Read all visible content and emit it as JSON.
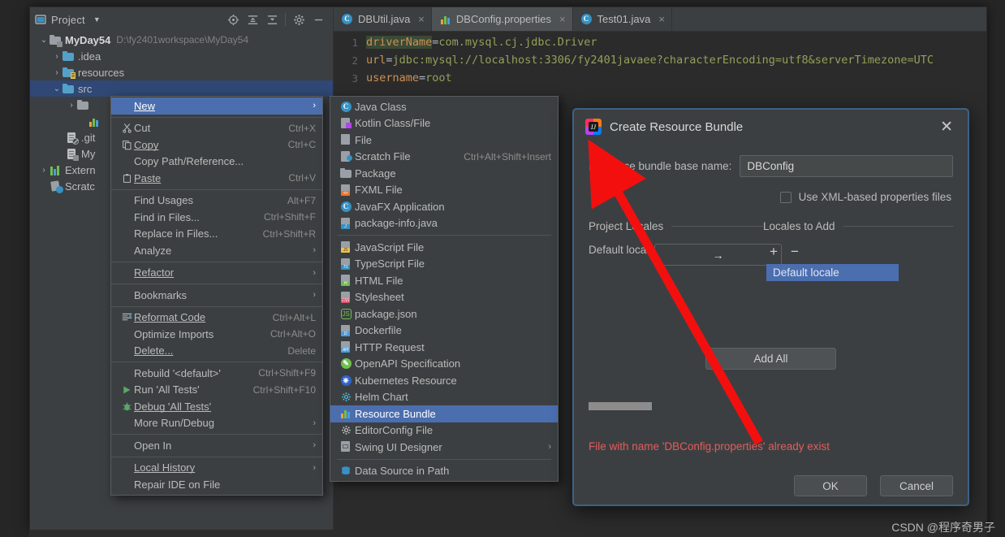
{
  "project_panel": {
    "header_title": "Project",
    "header_icons": [
      "project-view-icon",
      "chevron-down-icon",
      "locate-icon",
      "expand-all-icon",
      "collapse-all-icon",
      "settings-gear-icon",
      "hide-icon"
    ],
    "tree": [
      {
        "label": "MyDay54",
        "path": "D:\\fy2401workspace\\MyDay54",
        "icon": "module-folder-icon",
        "twisty": "⌄",
        "bold": true,
        "selected": false,
        "indent": 0
      },
      {
        "label": ".idea",
        "path": "",
        "icon": "folder-icon",
        "twisty": "›",
        "bold": false,
        "selected": false,
        "indent": 1
      },
      {
        "label": "resources",
        "path": "",
        "icon": "resources-folder-icon",
        "twisty": "›",
        "bold": false,
        "selected": false,
        "indent": 1
      },
      {
        "label": "src",
        "path": "",
        "icon": "folder-icon",
        "twisty": "⌄",
        "bold": false,
        "selected": true,
        "indent": 1
      },
      {
        "label": "",
        "path": "",
        "icon": "package-folder-icon",
        "twisty": "›",
        "bold": false,
        "selected": false,
        "indent": 2
      },
      {
        "label": "",
        "path": "",
        "icon": "resource-bundle-icon",
        "twisty": "",
        "bold": false,
        "selected": false,
        "indent": 3
      },
      {
        "label": ".git",
        "path": "",
        "icon": "gitignore-file-icon",
        "twisty": "",
        "bold": false,
        "selected": false,
        "indent": 2
      },
      {
        "label": "My",
        "path": "",
        "icon": "iml-file-icon",
        "twisty": "",
        "bold": false,
        "selected": false,
        "indent": 2
      },
      {
        "label": "Extern",
        "path": "",
        "icon": "external-libraries-icon",
        "twisty": "›",
        "bold": false,
        "selected": false,
        "indent": 0
      },
      {
        "label": "Scratc",
        "path": "",
        "icon": "scratches-icon",
        "twisty": "",
        "bold": false,
        "selected": false,
        "indent": 0
      }
    ]
  },
  "tabs": [
    {
      "label": "DBUtil.java",
      "icon": "java-class-icon",
      "active": false,
      "close": "×"
    },
    {
      "label": "DBConfig.properties",
      "icon": "resource-bundle-icon",
      "active": true,
      "close": "×"
    },
    {
      "label": "Test01.java",
      "icon": "java-class-icon",
      "active": false,
      "close": "×"
    }
  ],
  "editor": {
    "lines": [
      {
        "no": "1",
        "key": "driverName",
        "eq": "=",
        "value": "com.mysql.cj.jdbc.Driver",
        "highlight": true
      },
      {
        "no": "2",
        "key": "url",
        "eq": "=",
        "value": "jdbc:mysql://localhost:3306/fy2401javaee?characterEncoding=utf8&serverTimezone=UTC",
        "highlight": false
      },
      {
        "no": "3",
        "key": "username",
        "eq": "=",
        "value": "root",
        "highlight": false
      }
    ]
  },
  "context_menu": {
    "items": [
      {
        "label": "New",
        "mnemonic": "N",
        "shortcut": "",
        "icon": "",
        "arrow": "›",
        "selected": true
      },
      {
        "sep": true
      },
      {
        "label": "Cut",
        "mnemonic": "",
        "shortcut": "Ctrl+X",
        "icon": "cut-icon",
        "arrow": ""
      },
      {
        "label": "Copy",
        "mnemonic": "C",
        "shortcut": "Ctrl+C",
        "icon": "copy-icon",
        "arrow": ""
      },
      {
        "label": "Copy Path/Reference...",
        "mnemonic": "",
        "shortcut": "",
        "icon": "",
        "arrow": ""
      },
      {
        "label": "Paste",
        "mnemonic": "P",
        "shortcut": "Ctrl+V",
        "icon": "paste-icon",
        "arrow": ""
      },
      {
        "sep": true
      },
      {
        "label": "Find Usages",
        "mnemonic": "U",
        "shortcut": "Alt+F7",
        "icon": "",
        "arrow": ""
      },
      {
        "label": "Find in Files...",
        "mnemonic": "",
        "shortcut": "Ctrl+Shift+F",
        "icon": "",
        "arrow": ""
      },
      {
        "label": "Replace in Files...",
        "mnemonic": "a",
        "shortcut": "Ctrl+Shift+R",
        "icon": "",
        "arrow": ""
      },
      {
        "label": "Analyze",
        "mnemonic": "",
        "shortcut": "",
        "icon": "",
        "arrow": "›"
      },
      {
        "sep": true
      },
      {
        "label": "Refactor",
        "mnemonic": "R",
        "shortcut": "",
        "icon": "",
        "arrow": "›"
      },
      {
        "sep": true
      },
      {
        "label": "Bookmarks",
        "mnemonic": "",
        "shortcut": "",
        "icon": "",
        "arrow": "›"
      },
      {
        "sep": true
      },
      {
        "label": "Reformat Code",
        "mnemonic": "R",
        "shortcut": "Ctrl+Alt+L",
        "icon": "reformat-icon",
        "arrow": ""
      },
      {
        "label": "Optimize Imports",
        "mnemonic": "z",
        "shortcut": "Ctrl+Alt+O",
        "icon": "",
        "arrow": ""
      },
      {
        "label": "Delete...",
        "mnemonic": "D",
        "shortcut": "Delete",
        "icon": "",
        "arrow": ""
      },
      {
        "sep": true
      },
      {
        "label": "Rebuild '<default>'",
        "mnemonic": "",
        "shortcut": "Ctrl+Shift+F9",
        "icon": "",
        "arrow": ""
      },
      {
        "label": "Run 'All Tests'",
        "mnemonic": "u",
        "shortcut": "Ctrl+Shift+F10",
        "icon": "run-icon",
        "arrow": ""
      },
      {
        "label": "Debug 'All Tests'",
        "mnemonic": "D",
        "shortcut": "",
        "icon": "debug-icon",
        "arrow": ""
      },
      {
        "label": "More Run/Debug",
        "mnemonic": "",
        "shortcut": "",
        "icon": "",
        "arrow": "›"
      },
      {
        "sep": true
      },
      {
        "label": "Open In",
        "mnemonic": "",
        "shortcut": "",
        "icon": "",
        "arrow": "›"
      },
      {
        "sep": true
      },
      {
        "label": "Local History",
        "mnemonic": "H",
        "shortcut": "",
        "icon": "",
        "arrow": "›"
      },
      {
        "label": "Repair IDE on File",
        "mnemonic": "",
        "shortcut": "",
        "icon": "",
        "arrow": ""
      }
    ]
  },
  "new_submenu": {
    "items": [
      {
        "label": "Java Class",
        "shortcut": "",
        "icon": "java-class-icon",
        "arrow": ""
      },
      {
        "label": "Kotlin Class/File",
        "shortcut": "",
        "icon": "kotlin-file-icon",
        "arrow": ""
      },
      {
        "label": "File",
        "shortcut": "",
        "icon": "file-icon",
        "arrow": ""
      },
      {
        "label": "Scratch File",
        "shortcut": "Ctrl+Alt+Shift+Insert",
        "icon": "scratch-file-icon",
        "arrow": ""
      },
      {
        "label": "Package",
        "shortcut": "",
        "icon": "package-icon",
        "arrow": ""
      },
      {
        "label": "FXML File",
        "shortcut": "",
        "icon": "fxml-file-icon",
        "arrow": ""
      },
      {
        "label": "JavaFX Application",
        "shortcut": "",
        "icon": "javafx-icon",
        "arrow": ""
      },
      {
        "label": "package-info.java",
        "shortcut": "",
        "icon": "package-info-icon",
        "arrow": ""
      },
      {
        "sep": true
      },
      {
        "label": "JavaScript File",
        "shortcut": "",
        "icon": "javascript-file-icon",
        "arrow": ""
      },
      {
        "label": "TypeScript File",
        "shortcut": "",
        "icon": "typescript-file-icon",
        "arrow": ""
      },
      {
        "label": "HTML File",
        "shortcut": "",
        "icon": "html-file-icon",
        "arrow": ""
      },
      {
        "label": "Stylesheet",
        "shortcut": "",
        "icon": "stylesheet-icon",
        "arrow": ""
      },
      {
        "label": "package.json",
        "shortcut": "",
        "icon": "packagejson-icon",
        "arrow": ""
      },
      {
        "label": "Dockerfile",
        "shortcut": "",
        "icon": "dockerfile-icon",
        "arrow": ""
      },
      {
        "label": "HTTP Request",
        "shortcut": "",
        "icon": "http-request-icon",
        "arrow": ""
      },
      {
        "label": "OpenAPI Specification",
        "shortcut": "",
        "icon": "openapi-icon",
        "arrow": ""
      },
      {
        "label": "Kubernetes Resource",
        "shortcut": "",
        "icon": "kubernetes-icon",
        "arrow": ""
      },
      {
        "label": "Helm Chart",
        "shortcut": "",
        "icon": "helm-icon",
        "arrow": ""
      },
      {
        "label": "Resource Bundle",
        "shortcut": "",
        "icon": "resource-bundle-icon",
        "arrow": "",
        "selected": true
      },
      {
        "label": "EditorConfig File",
        "shortcut": "",
        "icon": "editorconfig-icon",
        "arrow": ""
      },
      {
        "label": "Swing UI Designer",
        "shortcut": "",
        "icon": "swing-ui-icon",
        "arrow": "›"
      },
      {
        "sep": true
      },
      {
        "label": "Data Source in Path",
        "shortcut": "",
        "icon": "data-source-icon",
        "arrow": ""
      }
    ]
  },
  "dialog": {
    "title": "Create Resource Bundle",
    "close_label": "✕",
    "basename_label": "Resource bundle base name:",
    "basename_value": "DBConfig",
    "basename_placeholder": "",
    "xml_checkbox_label": "Use XML-based properties files",
    "xml_checkbox_checked": false,
    "project_locales_label": "Project Locales",
    "locales_to_add_label": "Locales to Add",
    "default_locale_label": "Default locale",
    "move_right_label": "→",
    "add_icon": "+",
    "remove_icon": "−",
    "locale_chip_label": "Default locale",
    "add_all_label": "Add All",
    "error_message": "File with name 'DBConfig.properties' already exist",
    "ok_label": "OK",
    "cancel_label": "Cancel"
  },
  "annotation": {
    "arrow_color": "#f40f0f"
  },
  "watermark": {
    "text": "CSDN @程序奇男子"
  },
  "colors": {
    "accent_selection": "#4b6eaf",
    "panel_bg": "#3c3f41",
    "editor_bg": "#2b2b2b",
    "error_red": "#e35c5c",
    "dialog_border": "#3d6185"
  }
}
